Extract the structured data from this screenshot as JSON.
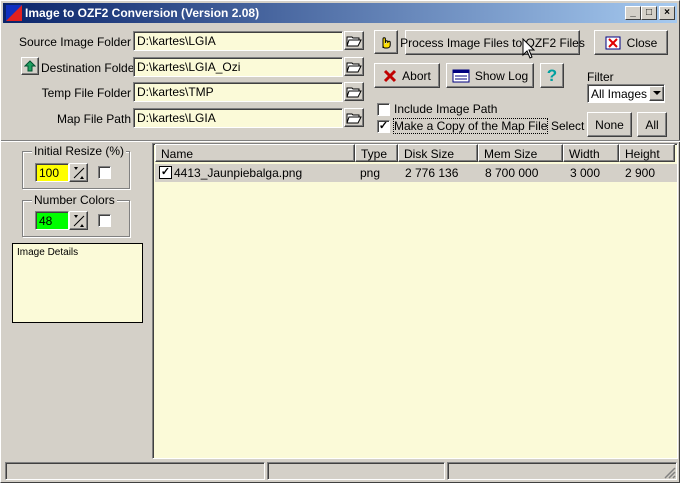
{
  "window": {
    "title": "Image to OZF2 Conversion (Version 2.08)",
    "controls": {
      "minimize": "_",
      "maximize": "□",
      "close": "×"
    }
  },
  "folders": {
    "source": {
      "label": "Source Image Folder",
      "value": "D:\\kartes\\LGIA"
    },
    "destination": {
      "label": "Destination Folder",
      "value": "D:\\kartes\\LGIA_Ozi"
    },
    "temp": {
      "label": "Temp File Folder",
      "value": "D:\\kartes\\TMP"
    },
    "map": {
      "label": "Map File Path",
      "value": "D:\\kartes\\LGIA"
    }
  },
  "buttons": {
    "process": "Process Image Files to OZF2 Files",
    "close": "Close",
    "abort": "Abort",
    "show_log": "Show Log",
    "help": "?",
    "none": "None",
    "all": "All"
  },
  "options": {
    "include_image_path": {
      "label": "Include Image Path",
      "checked": false
    },
    "copy_map_file": {
      "label": "Make a Copy of the Map File",
      "checked": true
    }
  },
  "filter": {
    "label": "Filter",
    "selected": "All Images"
  },
  "select_label": "Select",
  "resize": {
    "title": "Initial Resize (%)",
    "value": "100",
    "checked": false
  },
  "colors": {
    "title": "Number Colors",
    "value": "48",
    "checked": false
  },
  "image_details": {
    "label": "Image Details"
  },
  "table": {
    "columns": [
      "Name",
      "Type",
      "Disk Size",
      "Mem Size",
      "Width",
      "Height"
    ],
    "rows": [
      {
        "checked": true,
        "name": "4413_Jaunpiebalga.png",
        "type": "png",
        "disk_size": "2 776 136",
        "mem_size": "8 700 000",
        "width": "3 000",
        "height": "2 900"
      }
    ]
  },
  "colors_palette": {
    "title_start": "#0a246a",
    "title_end": "#a6caf0",
    "field_bg": "#fbfad8",
    "resize_bg": "#ffff00",
    "colors_bg": "#00ff00"
  }
}
